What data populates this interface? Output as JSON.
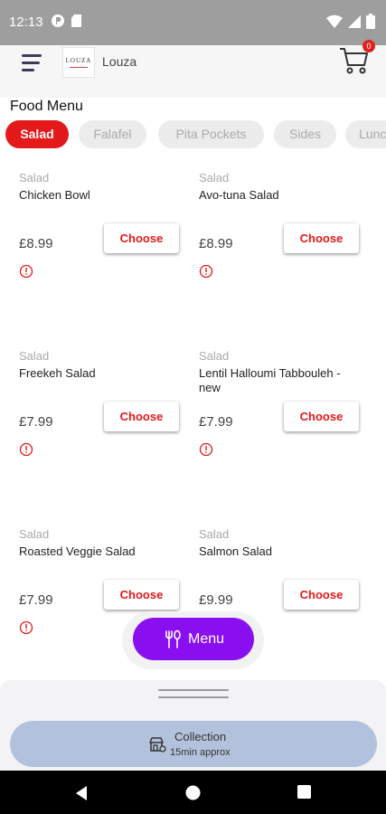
{
  "status_bar": {
    "time": "12:13",
    "icons": [
      "cast-icon",
      "sd-card-icon",
      "wifi-icon",
      "signal-icon",
      "battery-icon"
    ]
  },
  "header": {
    "logo_text": "LOUZA",
    "restaurant_name": "Louza",
    "cart_count": "0",
    "icons": [
      "hamburger-menu-icon",
      "cart-icon"
    ]
  },
  "food_menu_title": "Food Menu",
  "categories": [
    {
      "label": "Salad",
      "active": true
    },
    {
      "label": "Falafel",
      "active": false
    },
    {
      "label": "Pita Pockets",
      "active": false
    },
    {
      "label": "Sides",
      "active": false
    },
    {
      "label": "Lunc",
      "active": false
    }
  ],
  "items": [
    {
      "category": "Salad",
      "name": "Chicken Bowl",
      "price": "£8.99",
      "button": "Choose"
    },
    {
      "category": "Salad",
      "name": "Avo-tuna Salad",
      "price": "£8.99",
      "button": "Choose"
    },
    {
      "category": "Salad",
      "name": "Freekeh Salad",
      "price": "£7.99",
      "button": "Choose"
    },
    {
      "category": "Salad",
      "name": "Lentil Halloumi Tabbouleh - new",
      "price": "£7.99",
      "button": "Choose"
    },
    {
      "category": "Salad",
      "name": "Roasted Veggie Salad",
      "price": "£7.99",
      "button": "Choose"
    },
    {
      "category": "Salad",
      "name": "Salmon Salad",
      "price": "£9.99",
      "button": "Choose"
    }
  ],
  "menu_button": {
    "label": "Menu",
    "icon": "fork-spoon-icon"
  },
  "collection": {
    "label": "Collection",
    "sub": "15min approx",
    "icon": "store-icon"
  },
  "colors": {
    "accent_red": "#e3191a",
    "menu_purple": "#8a0ff0",
    "collection_blue": "#b3c2dc",
    "status_bar": "#9e9e9e"
  }
}
